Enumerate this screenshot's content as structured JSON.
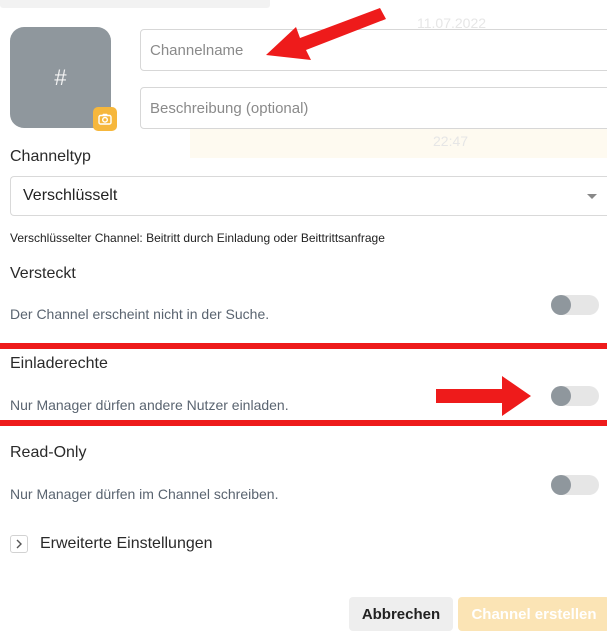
{
  "background": {
    "faint_date": "11.07.2022",
    "faint_time": "22:47"
  },
  "avatar": {
    "symbol": "#",
    "icon": "hash-icon",
    "camera_icon": "camera-icon",
    "camera_color": "#f6b73c"
  },
  "fields": {
    "name_placeholder": "Channelname",
    "description_placeholder": "Beschreibung (optional)"
  },
  "channel_type": {
    "label": "Channeltyp",
    "selected": "Verschlüsselt",
    "note": "Verschlüsselter Channel: Beitritt durch Einladung oder Beittrittsanfrage"
  },
  "settings": [
    {
      "title": "Versteckt",
      "description": "Der Channel erscheint nicht in der Suche.",
      "enabled": false
    },
    {
      "title": "Einladerechte",
      "description": "Nur Manager dürfen andere Nutzer einladen.",
      "enabled": false
    },
    {
      "title": "Read-Only",
      "description": "Nur Manager dürfen im Channel schreiben.",
      "enabled": false
    }
  ],
  "advanced": {
    "label": "Erweiterte Einstellungen"
  },
  "buttons": {
    "cancel": "Abbrechen",
    "create": "Channel erstellen"
  },
  "annotation_color": "#ee1b1b"
}
